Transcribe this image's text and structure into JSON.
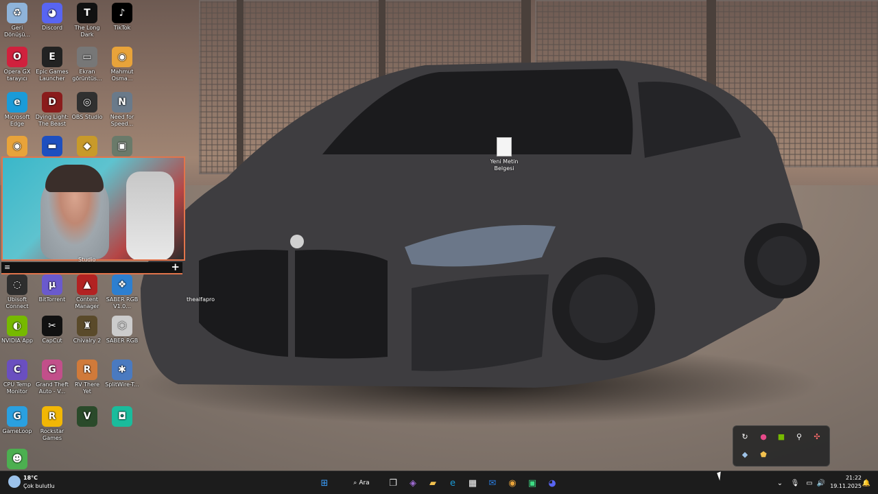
{
  "desktop": {
    "icons": [
      {
        "label": "Geri Dönüşü...",
        "icon": "recycle-bin-icon",
        "color": "#8fb3d9",
        "glyph": "♻"
      },
      {
        "label": "Discord",
        "icon": "discord-icon",
        "color": "#5865f2",
        "glyph": "◕"
      },
      {
        "label": "The Long Dark",
        "icon": "the-long-dark-icon",
        "color": "#111111",
        "glyph": "T"
      },
      {
        "label": "TikTok",
        "icon": "tiktok-icon",
        "color": "#000000",
        "glyph": "♪"
      },
      {
        "label": "Opera GX tarayıcı",
        "icon": "opera-gx-icon",
        "color": "#d0213d",
        "glyph": "O"
      },
      {
        "label": "Epic Games Launcher",
        "icon": "epic-games-icon",
        "color": "#222222",
        "glyph": "E"
      },
      {
        "label": "Ekran görüntüs...",
        "icon": "screenshot-icon",
        "color": "#777777",
        "glyph": "▭"
      },
      {
        "label": "Mahmut Osma...",
        "icon": "chrome-icon",
        "color": "#e8a33a",
        "glyph": "◉"
      },
      {
        "label": "Microsoft Edge",
        "icon": "edge-icon",
        "color": "#1a9bd8",
        "glyph": "e"
      },
      {
        "label": "Dying Light: The Beast",
        "icon": "dying-light-icon",
        "color": "#8a1c1c",
        "glyph": "D"
      },
      {
        "label": "OBS Studio",
        "icon": "obs-icon",
        "color": "#303030",
        "glyph": "◎"
      },
      {
        "label": "Need for Speed...",
        "icon": "need-for-speed-icon",
        "color": "#6a7a8a",
        "glyph": "N"
      },
      {
        "label": "Ubisoft Connect",
        "icon": "ubisoft-icon",
        "color": "#2e2e2e",
        "glyph": "◌"
      },
      {
        "label": "BitTorrent",
        "icon": "bittorrent-icon",
        "color": "#6a5acd",
        "glyph": "μ"
      },
      {
        "label": "Content Manager",
        "icon": "content-manager-icon",
        "color": "#b22222",
        "glyph": "▲"
      },
      {
        "label": "SABER RGB V1.0...",
        "icon": "saber-rgb-icon",
        "color": "#2d7fd0",
        "glyph": "❖"
      },
      {
        "label": "NVIDIA App",
        "icon": "nvidia-icon",
        "color": "#76b900",
        "glyph": "◐"
      },
      {
        "label": "CapCut",
        "icon": "capcut-icon",
        "color": "#111111",
        "glyph": "✂"
      },
      {
        "label": "Chivalry 2",
        "icon": "chivalry-icon",
        "color": "#5a4a2a",
        "glyph": "♜"
      },
      {
        "label": "SABER RGB",
        "icon": "saber-rgb-2-icon",
        "color": "#cccccc",
        "glyph": "⬡"
      },
      {
        "label": "CPU Temp Monitor",
        "icon": "cpu-temp-icon",
        "color": "#6a4fc0",
        "glyph": "C"
      },
      {
        "label": "Grand Theft Auto - V...",
        "icon": "gta-icon",
        "color": "#c24f8a",
        "glyph": "G"
      },
      {
        "label": "RV There Yet",
        "icon": "rv-there-yet-icon",
        "color": "#d07a3a",
        "glyph": "R"
      },
      {
        "label": "SplitWire-T...",
        "icon": "splitwire-icon",
        "color": "#4a7ac0",
        "glyph": "✱"
      },
      {
        "label": "GameLoop",
        "icon": "gameloop-icon",
        "color": "#2aa0e0",
        "glyph": "G"
      },
      {
        "label": "Rockstar Games",
        "icon": "rockstar-icon",
        "color": "#f2b705",
        "glyph": "R"
      },
      {
        "label": "",
        "icon": "gta-v-icon",
        "color": "#2a4a2a",
        "glyph": "V"
      },
      {
        "label": "",
        "icon": "app-teal-icon",
        "color": "#1abc9c",
        "glyph": "◘"
      },
      {
        "label": "",
        "icon": "app-green-icon",
        "color": "#4caf50",
        "glyph": "☻"
      }
    ],
    "row3_partial": [
      {
        "icon": "chrome-icon",
        "color": "#e8a33a",
        "glyph": "◉"
      },
      {
        "icon": "flag-icon",
        "color": "#1e4fbf",
        "glyph": "▬"
      },
      {
        "icon": "app-yellow-icon",
        "color": "#c89a2a",
        "glyph": "◆"
      },
      {
        "icon": "game-icon",
        "color": "#6a7a6a",
        "glyph": "▣"
      }
    ],
    "text_file": {
      "label": "Yeni Metin Belgesi"
    },
    "overlay_label": "thealfapro",
    "webcam_caption": "Studio"
  },
  "obs_bar": {
    "left_glyph": "≡",
    "right_glyph": "+"
  },
  "tray_flyout": [
    {
      "icon": "refresh-icon",
      "glyph": "↻",
      "color": "#ffffff"
    },
    {
      "icon": "pink-app-icon",
      "glyph": "●",
      "color": "#e84a8a"
    },
    {
      "icon": "nvidia-tray-icon",
      "glyph": "■",
      "color": "#76b900"
    },
    {
      "icon": "usb-icon",
      "glyph": "⚲",
      "color": "#ffffff"
    },
    {
      "icon": "pinwheel-icon",
      "glyph": "✣",
      "color": "#ff6b6b"
    },
    {
      "icon": "steam-icon",
      "glyph": "◆",
      "color": "#9ec3e8"
    },
    {
      "icon": "shield-app-icon",
      "glyph": "⬟",
      "color": "#f2c14e"
    }
  ],
  "taskbar": {
    "weather": {
      "temp": "18°C",
      "condition": "Çok bulutlu"
    },
    "search_label": "Ara",
    "apps": [
      {
        "icon": "windows-start-icon",
        "glyph": "⊞",
        "color": "#3aa0ff"
      },
      {
        "icon": "task-view-icon",
        "glyph": "❐",
        "color": "#dddddd"
      },
      {
        "icon": "widgets-icon",
        "glyph": "◈",
        "color": "#a06cd5"
      },
      {
        "icon": "file-explorer-icon",
        "glyph": "▰",
        "color": "#f2c14e"
      },
      {
        "icon": "edge-taskbar-icon",
        "glyph": "e",
        "color": "#1a9bd8"
      },
      {
        "icon": "store-icon",
        "glyph": "▦",
        "color": "#ffffff"
      },
      {
        "icon": "mail-icon",
        "glyph": "✉",
        "color": "#2a7de1"
      },
      {
        "icon": "chrome-taskbar-icon",
        "glyph": "◉",
        "color": "#e8a33a"
      },
      {
        "icon": "app-green-taskbar-icon",
        "glyph": "▣",
        "color": "#3ddc84"
      },
      {
        "icon": "discord-taskbar-icon",
        "glyph": "◕",
        "color": "#5865f2"
      }
    ],
    "tray": [
      {
        "icon": "chevron-up-icon",
        "glyph": "⌄"
      },
      {
        "icon": "microphone-icon",
        "glyph": "🎙"
      },
      {
        "icon": "network-icon",
        "glyph": "▭"
      },
      {
        "icon": "volume-icon",
        "glyph": "🔊"
      }
    ],
    "time": "21:22",
    "date": "19.11.2025",
    "notification_glyph": "🔔"
  }
}
